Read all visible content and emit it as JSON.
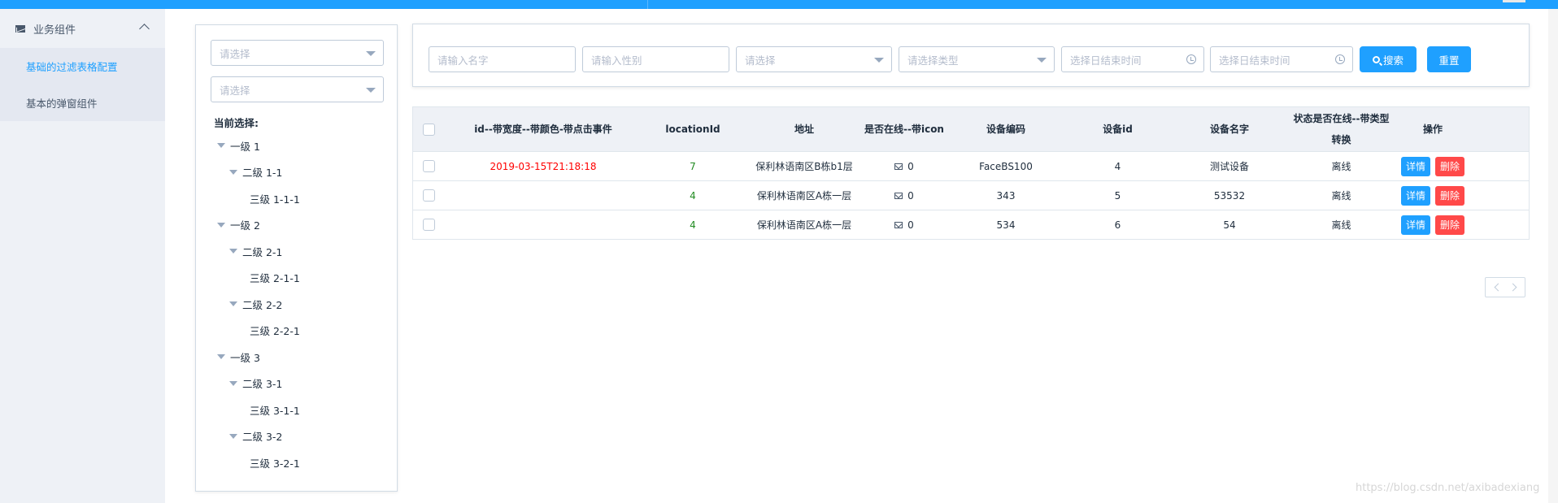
{
  "sidebar": {
    "group_label": "业务组件",
    "items": [
      {
        "label": "基础的过滤表格配置"
      },
      {
        "label": "基本的弹窗组件"
      }
    ]
  },
  "left_panel": {
    "select1_placeholder": "请选择",
    "select2_placeholder": "请选择",
    "current_label": "当前选择:",
    "tree": [
      {
        "label": "一级 1"
      },
      {
        "label": "二级 1-1"
      },
      {
        "label": "三级 1-1-1"
      },
      {
        "label": "一级 2"
      },
      {
        "label": "二级 2-1"
      },
      {
        "label": "三级 2-1-1"
      },
      {
        "label": "二级 2-2"
      },
      {
        "label": "三级 2-2-1"
      },
      {
        "label": "一级 3"
      },
      {
        "label": "二级 3-1"
      },
      {
        "label": "三级 3-1-1"
      },
      {
        "label": "二级 3-2"
      },
      {
        "label": "三级 3-2-1"
      }
    ]
  },
  "filters": {
    "name_placeholder": "请输入名字",
    "gender_placeholder": "请输入性别",
    "select_placeholder": "请选择",
    "type_placeholder": "请选择类型",
    "date1_placeholder": "选择日结束时间",
    "date2_placeholder": "选择日结束时间",
    "search_label": "搜索",
    "reset_label": "重置"
  },
  "table": {
    "headers": {
      "id": "id--带宽度--带颜色-带点击事件",
      "locationId": "locationId",
      "address": "地址",
      "online": "是否在线--带icon",
      "code": "设备编码",
      "deviceId": "设备id",
      "deviceName": "设备名字",
      "status": "状态是否在线--带类型转换",
      "actions": "操作"
    },
    "rows": [
      {
        "id": "2019-03-15T21:18:18",
        "locationId": "7",
        "address": "保利林语南区B栋b1层",
        "online": "0",
        "code": "FaceBS100",
        "deviceId": "4",
        "deviceName": "测试设备",
        "status": "离线",
        "detail": "详情",
        "delete": "删除"
      },
      {
        "id": "",
        "locationId": "4",
        "address": "保利林语南区A栋一层",
        "online": "0",
        "code": "343",
        "deviceId": "5",
        "deviceName": "53532",
        "status": "离线",
        "detail": "详情",
        "delete": "删除"
      },
      {
        "id": "",
        "locationId": "4",
        "address": "保利林语南区A栋一层",
        "online": "0",
        "code": "534",
        "deviceId": "6",
        "deviceName": "54",
        "status": "离线",
        "detail": "详情",
        "delete": "删除"
      }
    ]
  },
  "watermark": "https://blog.csdn.net/axibadexiang",
  "colors": {
    "primary": "#1fa0ff",
    "danger": "#ff4949",
    "id_text": "#ff0000",
    "location_text": "#228b22"
  }
}
